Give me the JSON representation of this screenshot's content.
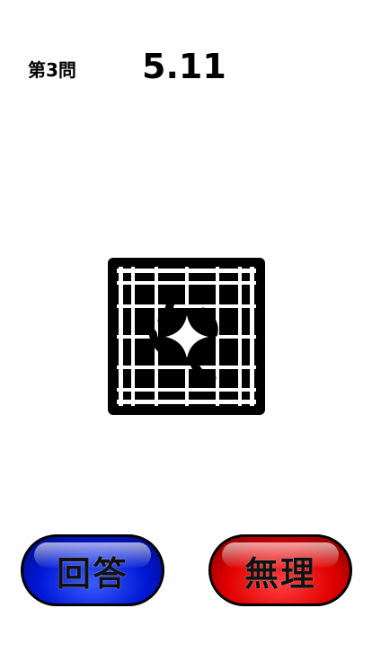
{
  "header": {
    "question_label": "第3問",
    "timer": "5.11"
  },
  "puzzle": {
    "icon": "kanji-grid-puzzle-image"
  },
  "buttons": {
    "answer_label": "回答",
    "giveup_label": "無理"
  },
  "colors": {
    "answer": "#0018d6",
    "giveup": "#e00000"
  }
}
